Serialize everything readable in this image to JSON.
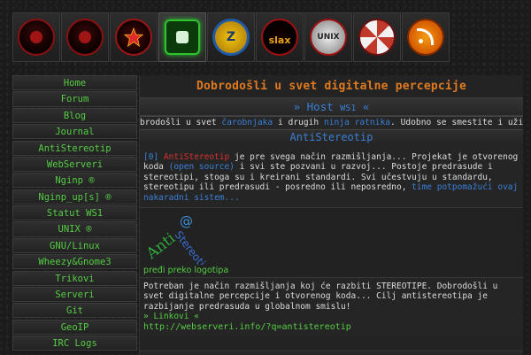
{
  "icons": [
    {
      "name": "red-ring-icon"
    },
    {
      "name": "red-ring-icon-2"
    },
    {
      "name": "red-star-icon"
    },
    {
      "name": "green-app-icon"
    },
    {
      "name": "yellow-globe-icon",
      "label": "Z"
    },
    {
      "name": "slax-icon",
      "label": "slax"
    },
    {
      "name": "unix-icon",
      "label": "UNIX"
    },
    {
      "name": "umbrella-icon"
    },
    {
      "name": "rss-icon"
    }
  ],
  "sidebar": {
    "items": [
      "Home",
      "Forum",
      "Blog",
      "Journal",
      "AntiStereotip",
      "WebServeri",
      "Nginp ®",
      "Nginp_up[s] ®",
      "Statut WS1",
      "UNIX ®",
      "GNU/Linux",
      "Wheezy&Gnome3",
      "Trikovi",
      "Serveri",
      "Git",
      "GeoIP",
      "IRC Logs"
    ]
  },
  "main": {
    "site_title": "Dobrodošli u svet digitalne percepcije",
    "host_prefix": "» Host ",
    "host_name": "WS1",
    "host_suffix": " «",
    "marquee_1": "brodošli u svet ",
    "marquee_2": "čarobnjaka",
    "marquee_3": " i drugih ",
    "marquee_4": "ninja ratnika",
    "marquee_5": ". Udobno se smestite i uživaj",
    "antistereotip_heading": "AntiStereotip",
    "post_index": "[0]",
    "post_red": "AntiStereotip",
    "post_text_1": " je pre svega način razmišljanja... Projekat je otvorenog koda ",
    "post_paren": "(open source)",
    "post_text_2": " i svi ste pozvani u razvoj... Postoje predrasude i stereotipi, stoga su i kreirani standardi. Svi učestvuju u standardu, stereotipu ili predrasudi - posredno ili neposredno, ",
    "post_blue_end": "time potpomažući ovaj nakaradni sistem...",
    "logo_caption": "pređi preko logotipa",
    "post2_text": "Potreban je način razmišljanja koj će razbiti STEREOTIPE. Dobrodošli u svet digitalne percepcije i otvorenog koda... Cilj antistereotipa je razbijanje predrasuda u globalnom smislu!",
    "links_label": "» Linkovi «",
    "link_url": "http://webserveri.info/?q=antistereotip"
  }
}
